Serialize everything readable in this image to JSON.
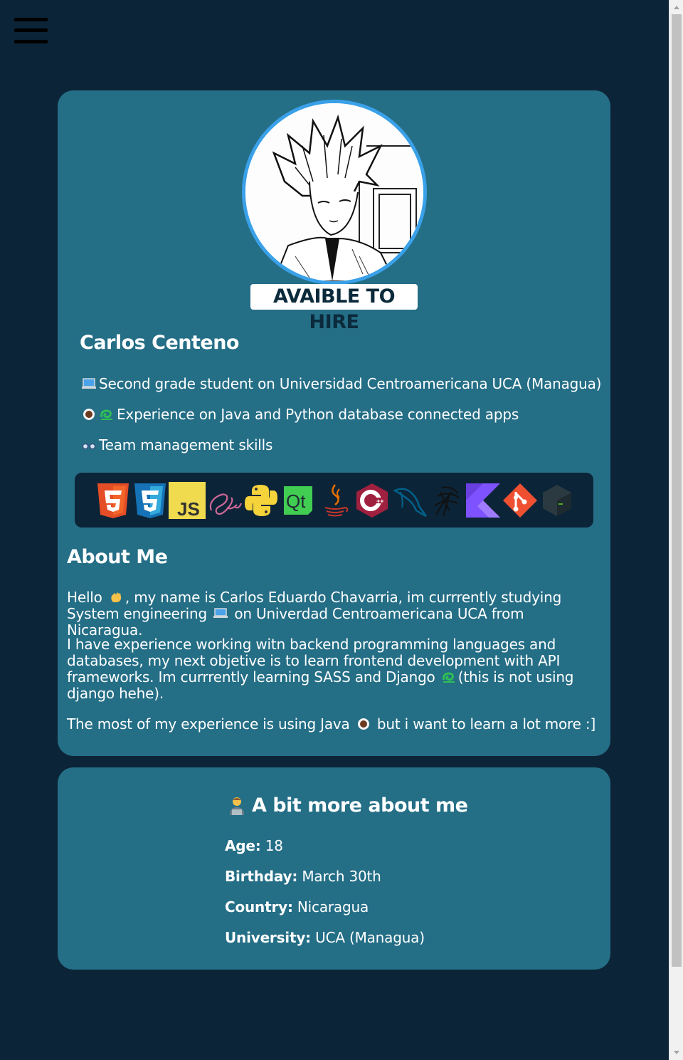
{
  "nav": {
    "menu_icon": "hamburger-menu-icon"
  },
  "profile": {
    "avatar_icon": "manga-portrait-avatar",
    "hire_badge": "AVAIBLE TO HIRE",
    "name": "Carlos Centeno",
    "bullets": [
      {
        "icon": "laptop-emoji",
        "text": "Second grade student on Universidad Centroamericana UCA (Managua)"
      },
      {
        "icon": "coffee-and-snake-emoji",
        "text": "Experience on Java and Python database connected apps"
      },
      {
        "icon": "glasses-emoji",
        "text": "Team management skills"
      }
    ],
    "skills": [
      "html5-icon",
      "css3-icon",
      "javascript-icon",
      "sass-icon",
      "python-icon",
      "qt-icon",
      "java-icon",
      "cplusplus-icon",
      "mysql-icon",
      "sqlalchemy-icon",
      "kotlin-icon",
      "git-icon",
      "bash-icon"
    ],
    "skill_labels": {
      "js": "JS",
      "qt": "Qt"
    }
  },
  "about": {
    "title": "About Me",
    "p1_a": "Hello",
    "p1_b": ", my name is Carlos Eduardo Chavarria, im currrently studying System engineering",
    "p1_c": " on Univerdad Centroamericana UCA from Nicaragua.",
    "p2_a": "I have experience working witn backend programming languages and databases, my next objetive is to learn frontend development with API frameworks. Im currrently learning SASS and Django",
    "p2_b": "(this is not using django hehe).",
    "p3_a": "The most of my experience is using Java",
    "p3_b": " but i want to learn a lot more :]"
  },
  "more": {
    "title": "A bit more about me",
    "rows": [
      {
        "label": "Age:",
        "value": " 18"
      },
      {
        "label": "Birthday:",
        "value": " March 30th"
      },
      {
        "label": "Country:",
        "value": " Nicaragua"
      },
      {
        "label": "University:",
        "value": " UCA (Managua)"
      }
    ]
  },
  "colors": {
    "page_bg": "#0c2437",
    "card_bg": "#246e86",
    "avatar_ring": "#3aa0e8"
  }
}
